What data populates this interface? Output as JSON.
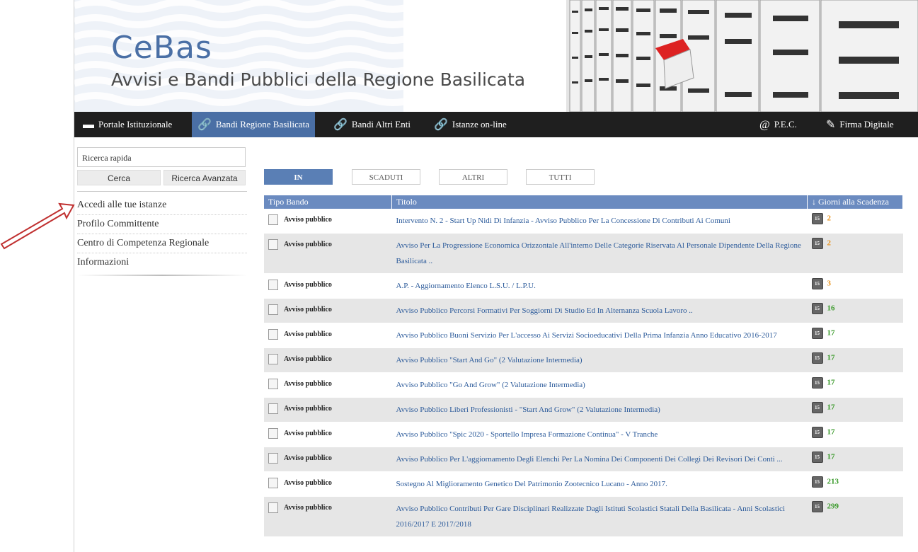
{
  "header": {
    "logo": "CeBas",
    "subtitle": "Avvisi e Bandi Pubblici della Regione Basilicata"
  },
  "nav": {
    "items": [
      {
        "label": "Portale Istituzionale",
        "icon": "portal-icon"
      },
      {
        "label": "Bandi Regione Basilicata",
        "icon": "link-icon",
        "active": true
      },
      {
        "label": "Bandi Altri Enti",
        "icon": "link-icon"
      },
      {
        "label": "Istanze on-line",
        "icon": "link-icon"
      },
      {
        "label": "P.E.C.",
        "icon": "at-icon"
      },
      {
        "label": "Firma Digitale",
        "icon": "pen-icon"
      }
    ]
  },
  "sidebar": {
    "search_value": "Ricerca rapida",
    "search_button": "Cerca",
    "advanced_button": "Ricerca Avanzata",
    "links": [
      "Accedi alle tue istanze",
      "Profilo Committente",
      "Centro di Competenza Regionale",
      "Informazioni"
    ]
  },
  "tabs": [
    "IN",
    "SCADUTI",
    "ALTRI",
    "TUTTI"
  ],
  "table": {
    "headers": [
      "Tipo Bando",
      "Titolo",
      "↓ Giorni alla Scadenza"
    ],
    "rows": [
      {
        "tipo": "Avviso pubblico",
        "titolo": "Intervento N. 2 - Start Up Nidi Di Infanzia - Avviso Pubblico Per La Concessione Di Contributi Ai Comuni",
        "giorni": "2",
        "color": "#e8921a"
      },
      {
        "tipo": "Avviso pubblico",
        "titolo": "Avviso Per La Progressione Economica Orizzontale All'interno Delle Categorie Riservata Al Personale Dipendente Della Regione Basilicata ..",
        "giorni": "2",
        "color": "#e8921a"
      },
      {
        "tipo": "Avviso pubblico",
        "titolo": "A.P. - Aggiornamento Elenco L.S.U. / L.P.U.",
        "giorni": "3",
        "color": "#e8921a"
      },
      {
        "tipo": "Avviso pubblico",
        "titolo": "Avviso Pubblico Percorsi Formativi Per Soggiorni Di Studio Ed In Alternanza Scuola Lavoro ..",
        "giorni": "16",
        "color": "#3a9a2a"
      },
      {
        "tipo": "Avviso pubblico",
        "titolo": "Avviso Pubblico Buoni Servizio Per L'accesso Ai Servizi Socioeducativi Della Prima Infanzia Anno Educativo 2016-2017",
        "giorni": "17",
        "color": "#3a9a2a"
      },
      {
        "tipo": "Avviso pubblico",
        "titolo": "Avviso Pubblico \"Start And Go\" (2 Valutazione Intermedia)",
        "giorni": "17",
        "color": "#3a9a2a"
      },
      {
        "tipo": "Avviso pubblico",
        "titolo": "Avviso Pubblico \"Go And Grow\" (2 Valutazione Intermedia)",
        "giorni": "17",
        "color": "#3a9a2a"
      },
      {
        "tipo": "Avviso pubblico",
        "titolo": "Avviso Pubblico Liberi Professionisti - \"Start And Grow\" (2 Valutazione Intermedia)",
        "giorni": "17",
        "color": "#3a9a2a"
      },
      {
        "tipo": "Avviso pubblico",
        "titolo": "Avviso Pubblico \"Spic 2020 - Sportello Impresa Formazione Continua\" - V Tranche",
        "giorni": "17",
        "color": "#3a9a2a"
      },
      {
        "tipo": "Avviso pubblico",
        "titolo": "Avviso Pubblico Per L'aggiornamento Degli Elenchi Per La Nomina Dei Componenti Dei Collegi Dei Revisori Dei Conti ...",
        "giorni": "17",
        "color": "#3a9a2a"
      },
      {
        "tipo": "Avviso pubblico",
        "titolo": "Sostegno Al Miglioramento Genetico Del Patrimonio Zootecnico Lucano - Anno 2017.",
        "giorni": "213",
        "color": "#3a9a2a"
      },
      {
        "tipo": "Avviso pubblico",
        "titolo": "Avviso Pubblico Contributi Per Gare Disciplinari Realizzate Dagli Istituti Scolastici Statali Della Basilicata - Anni Scolastici 2016/2017 E 2017/2018",
        "giorni": "299",
        "color": "#3a9a2a"
      }
    ]
  }
}
